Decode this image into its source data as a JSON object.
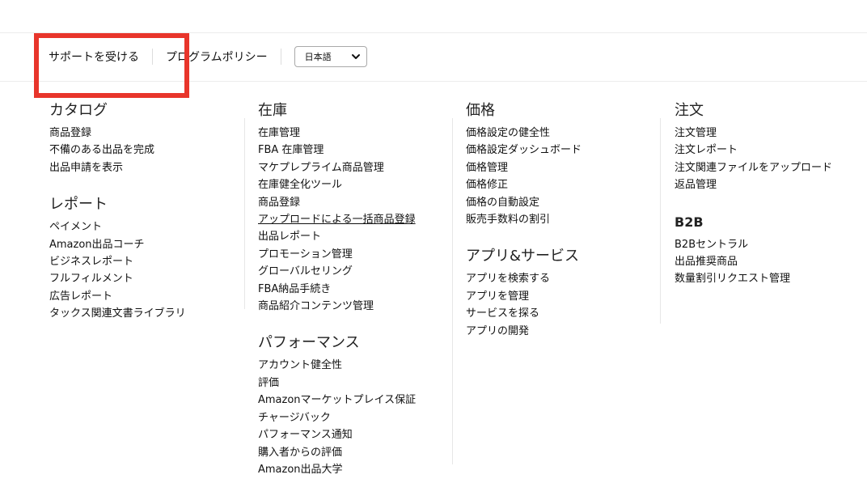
{
  "help_bar": {
    "support_link": "サポートを受ける",
    "policy_link": "プログラムポリシー",
    "language_select": "日本語"
  },
  "columns": [
    {
      "sections": [
        {
          "title": "カタログ",
          "items": [
            "商品登録",
            "不備のある出品を完成",
            "出品申請を表示"
          ]
        },
        {
          "title": "レポート",
          "items": [
            "ペイメント",
            "Amazon出品コーチ",
            "ビジネスレポート",
            "フルフィルメント",
            "広告レポート",
            "タックス関連文書ライブラリ"
          ]
        }
      ]
    },
    {
      "sections": [
        {
          "title": "在庫",
          "items": [
            "在庫管理",
            "FBA 在庫管理",
            "マケプレプライム商品管理",
            "在庫健全化ツール",
            "商品登録",
            "アップロードによる一括商品登録",
            "出品レポート",
            "プロモーション管理",
            "グローバルセリング",
            "FBA納品手続き",
            "商品紹介コンテンツ管理"
          ]
        },
        {
          "title": "パフォーマンス",
          "items": [
            "アカウント健全性",
            "評価",
            "Amazonマーケットプレイス保証",
            "チャージバック",
            "パフォーマンス通知",
            "購入者からの評価",
            "Amazon出品大学"
          ]
        }
      ]
    },
    {
      "sections": [
        {
          "title": "価格",
          "items": [
            "価格設定の健全性",
            "価格設定ダッシュボード",
            "価格管理",
            "価格修正",
            "価格の自動設定",
            "販売手数料の割引"
          ]
        },
        {
          "title": "アプリ&サービス",
          "items": [
            "アプリを検索する",
            "アプリを管理",
            "サービスを探る",
            "アプリの開発"
          ]
        }
      ]
    },
    {
      "sections": [
        {
          "title": "注文",
          "items": [
            "注文管理",
            "注文レポート",
            "注文関連ファイルをアップロード",
            "返品管理"
          ]
        },
        {
          "title": "B2B",
          "items": [
            "B2Bセントラル",
            "出品推奨商品",
            "数量割引リクエスト管理"
          ]
        }
      ]
    }
  ],
  "colors": {
    "highlight": "#e8352b",
    "text": "#111111",
    "divider": "#e6e6e6"
  }
}
